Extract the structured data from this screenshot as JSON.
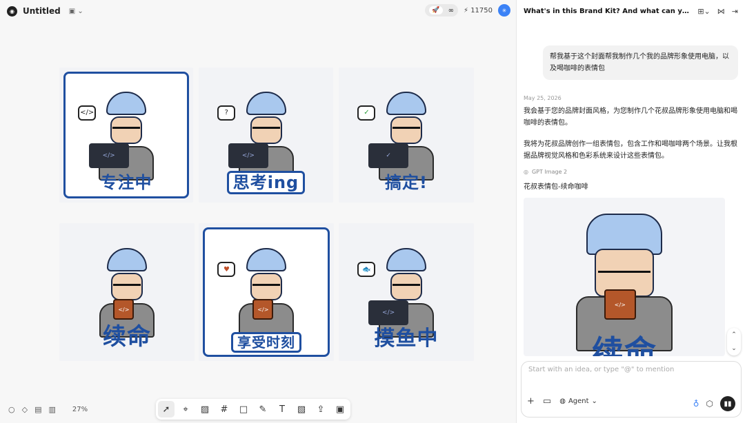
{
  "app": {
    "title": "Untitled",
    "credits": "11750",
    "avatar_initial": "·",
    "mode_icon": "rocket-icon",
    "infinite_icon": "∞"
  },
  "stickers": [
    {
      "caption": "专注中",
      "prop": "</>"
    },
    {
      "caption": "思考ing",
      "prop": "</>"
    },
    {
      "caption": "搞定!",
      "prop": "✓"
    },
    {
      "caption": "续命",
      "prop": "</>"
    },
    {
      "caption": "享受时刻",
      "prop": "</>"
    },
    {
      "caption": "摸鱼中",
      "prop": "</>"
    }
  ],
  "bottom": {
    "zoom": "27%"
  },
  "panel": {
    "title": "What's in this Brand Kit? And what can you d...",
    "user_message": "帮我基于这个封面帮我制作几个我的品牌形象使用电脑，以及喝咖啡的表情包",
    "date": "May 25, 2026",
    "ai_p1": "我会基于您的品牌封面风格，为您制作几个花叔品牌形象使用电脑和喝咖啡的表情包。",
    "ai_p2": "我将为花叔品牌创作一组表情包，包含工作和喝咖啡两个场景。让我根据品牌视觉风格和色彩系统来设计这些表情包。",
    "model": "GPT Image 2",
    "image_title": "花叔表情包-续命咖啡",
    "result_caption": "续命"
  },
  "composer": {
    "placeholder": "Start with an idea, or type \"@\" to mention",
    "agent_label": "Agent"
  }
}
